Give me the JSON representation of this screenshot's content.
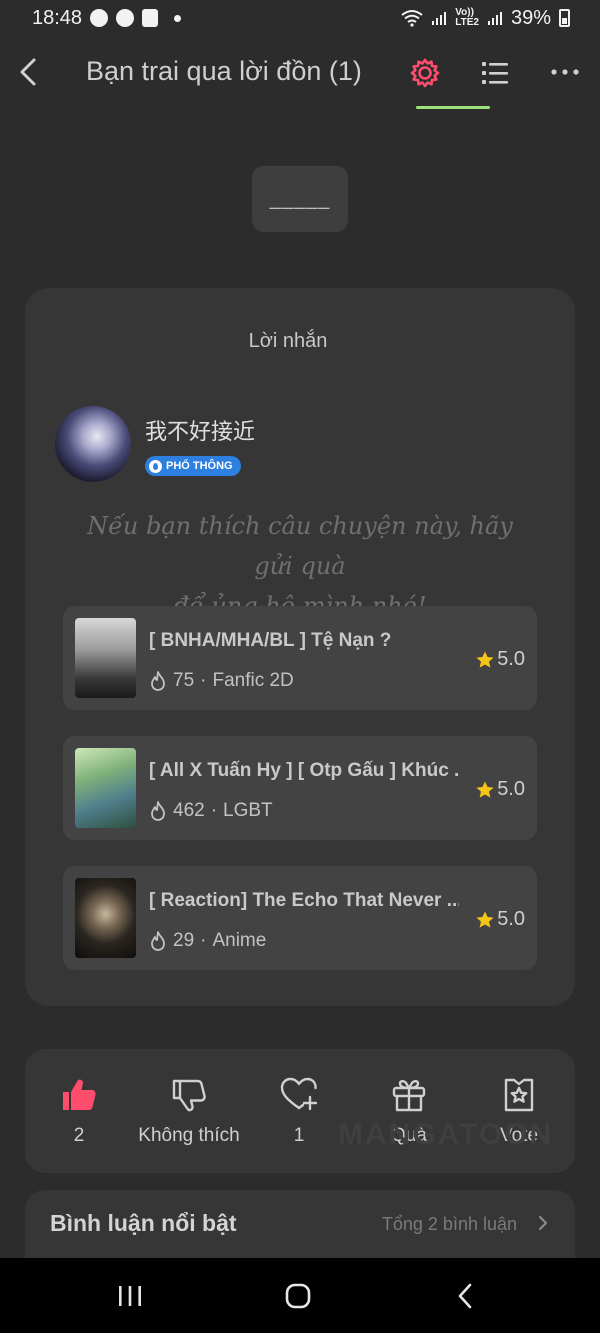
{
  "status_bar": {
    "time": "18:48",
    "network_top": "Vo))",
    "network_bottom": "LTE2",
    "battery": "39%"
  },
  "header": {
    "back_icon": "chevron-left-icon",
    "title": "Bạn trai qua lời đồn (1)",
    "settings_icon": "gear-icon",
    "settings_color": "#ff4d6d",
    "list_icon": "list-icon",
    "more_icon": "more-icon"
  },
  "accent": {
    "green": "#9be37a",
    "red_like": "#ff4d6d",
    "badge_blue": "#2d7fe0",
    "star_yellow": "#f5c518"
  },
  "dash_button": {
    "label": "_____"
  },
  "note": {
    "title": "Lời nhắn",
    "author": {
      "name": "我不好接近",
      "badge": "PHỔ THÔNG"
    },
    "message_line1": "Nếu bạn thích câu chuyện này, hãy gửi quà",
    "message_line2": "để ủng hộ mình nhé!"
  },
  "stories": [
    {
      "title": "[ BNHA/MHA/BL ] Tệ Nạn ?",
      "views": "75",
      "genre": "Fanfic 2D",
      "rating": "5.0"
    },
    {
      "title": "[ All X Tuấn Hy ] [ Otp Gấu ] Khúc ...",
      "views": "462",
      "genre": "LGBT",
      "rating": "5.0"
    },
    {
      "title": "[ Reaction] The Echo That Never ...",
      "views": "29",
      "genre": "Anime",
      "rating": "5.0"
    }
  ],
  "actions": {
    "like": {
      "icon": "thumbs-up-icon",
      "label": "2"
    },
    "dislike": {
      "icon": "thumbs-down-icon",
      "label": "Không thích"
    },
    "favorite": {
      "icon": "heart-plus-icon",
      "label": "1"
    },
    "gift": {
      "icon": "gift-icon",
      "label": "Quà"
    },
    "vote": {
      "icon": "vote-icon",
      "label": "Vote"
    },
    "watermark": "MANGATOON"
  },
  "comments": {
    "title": "Bình luận nổi bật",
    "count": "Tổng 2 bình luận"
  }
}
